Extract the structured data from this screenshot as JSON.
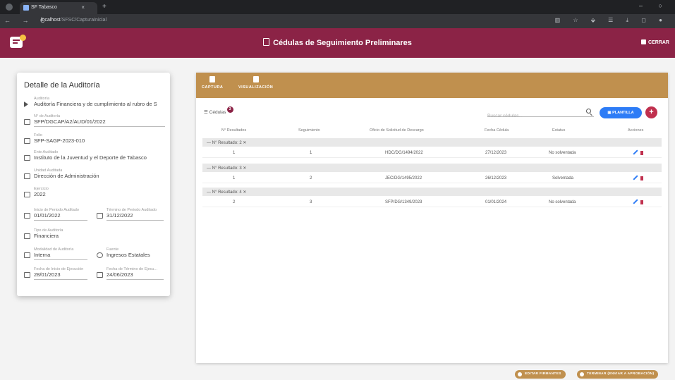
{
  "browser": {
    "tab_title": "SF Tabasco",
    "tab_close": "×",
    "new_tab": "+",
    "nav": "← → C",
    "url_host": "localhost",
    "url_path": "/SFSC/CapturaInicial",
    "window_controls": "– ○",
    "bar_icons": "▥ ☆ ⬙ ☰ ⤓ ◻ ●"
  },
  "header": {
    "title": "Cédulas de Seguimiento Preliminares",
    "logout_label": "CERRAR",
    "brand_color": "#8b2346"
  },
  "detail": {
    "title": "Detalle de la Auditoría",
    "fields": [
      {
        "label": "Auditoría",
        "value": "Auditoría Financiera y de cumplimiento al rubro de S"
      },
      {
        "label": "N° de Auditoría",
        "value": "SFP/DGCAP/A2/AUD/01/2022"
      },
      {
        "label": "Folio",
        "value": "SFP-SAGP-2023-010"
      },
      {
        "label": "Ente Auditado",
        "value": "Instituto de la Juventud y el Deporte de Tabasco"
      },
      {
        "label": "Unidad Auditada",
        "value": "Dirección de Administración"
      },
      {
        "label": "Ejercicio",
        "value": "2022"
      },
      {
        "label": "Inicio de Periodo Auditado",
        "value": "01/01/2022"
      },
      {
        "label": "Término de Periodo Auditado",
        "value": "31/12/2022"
      },
      {
        "label": "Tipo de Auditoría",
        "value": "Financiera"
      },
      {
        "label": "Modalidad de Auditoría",
        "value": "Interna"
      },
      {
        "label": "Fuente",
        "value": "Ingresos Estatales"
      },
      {
        "label": "Fecha de Inicio de Ejecución",
        "value": "28/01/2023"
      },
      {
        "label": "Fecha de Término de Ejecu...",
        "value": "24/06/2023"
      }
    ]
  },
  "panel": {
    "tabs": [
      {
        "label": "CAPTURA"
      },
      {
        "label": "VISUALIZACIÓN"
      }
    ],
    "cedulas_label": "Cédulas",
    "cedulas_count": "3",
    "search_placeholder": "Buscar cédulas...",
    "plantilla_label": "PLANTILLA",
    "add_label": "+",
    "accent_color": "#c0904e",
    "columns": [
      "N° Resultados",
      "Seguimiento",
      "Oficio de Solicitud de Descargo",
      "Fecha Cédula",
      "Estatus",
      "Acciones"
    ],
    "groups": [
      {
        "label": "— N° Resultado: 2 ✕",
        "row": {
          "seg": "1",
          "oficio": "HDC/DG/1494/2022",
          "fecha": "27/12/2023",
          "estatus": "No solventada"
        }
      },
      {
        "label": "— N° Resultado: 3 ✕",
        "row": {
          "seg": "2",
          "oficio": "JEC/DG/1495/2022",
          "fecha": "26/12/2023",
          "estatus": "Solventada"
        }
      },
      {
        "label": "— N° Resultado: 4 ✕",
        "row": {
          "num": "2",
          "seg": "3",
          "oficio": "SFP/DG/1349/2023",
          "fecha": "01/01/2024",
          "estatus": "No solventada"
        }
      }
    ],
    "first_rows_num": [
      "1",
      "1"
    ]
  },
  "footer": {
    "btn_firmantes": "EDITAR FIRMANTES",
    "btn_terminar": "TERMINAR (ENVIAR A APROBACIÓN)"
  }
}
